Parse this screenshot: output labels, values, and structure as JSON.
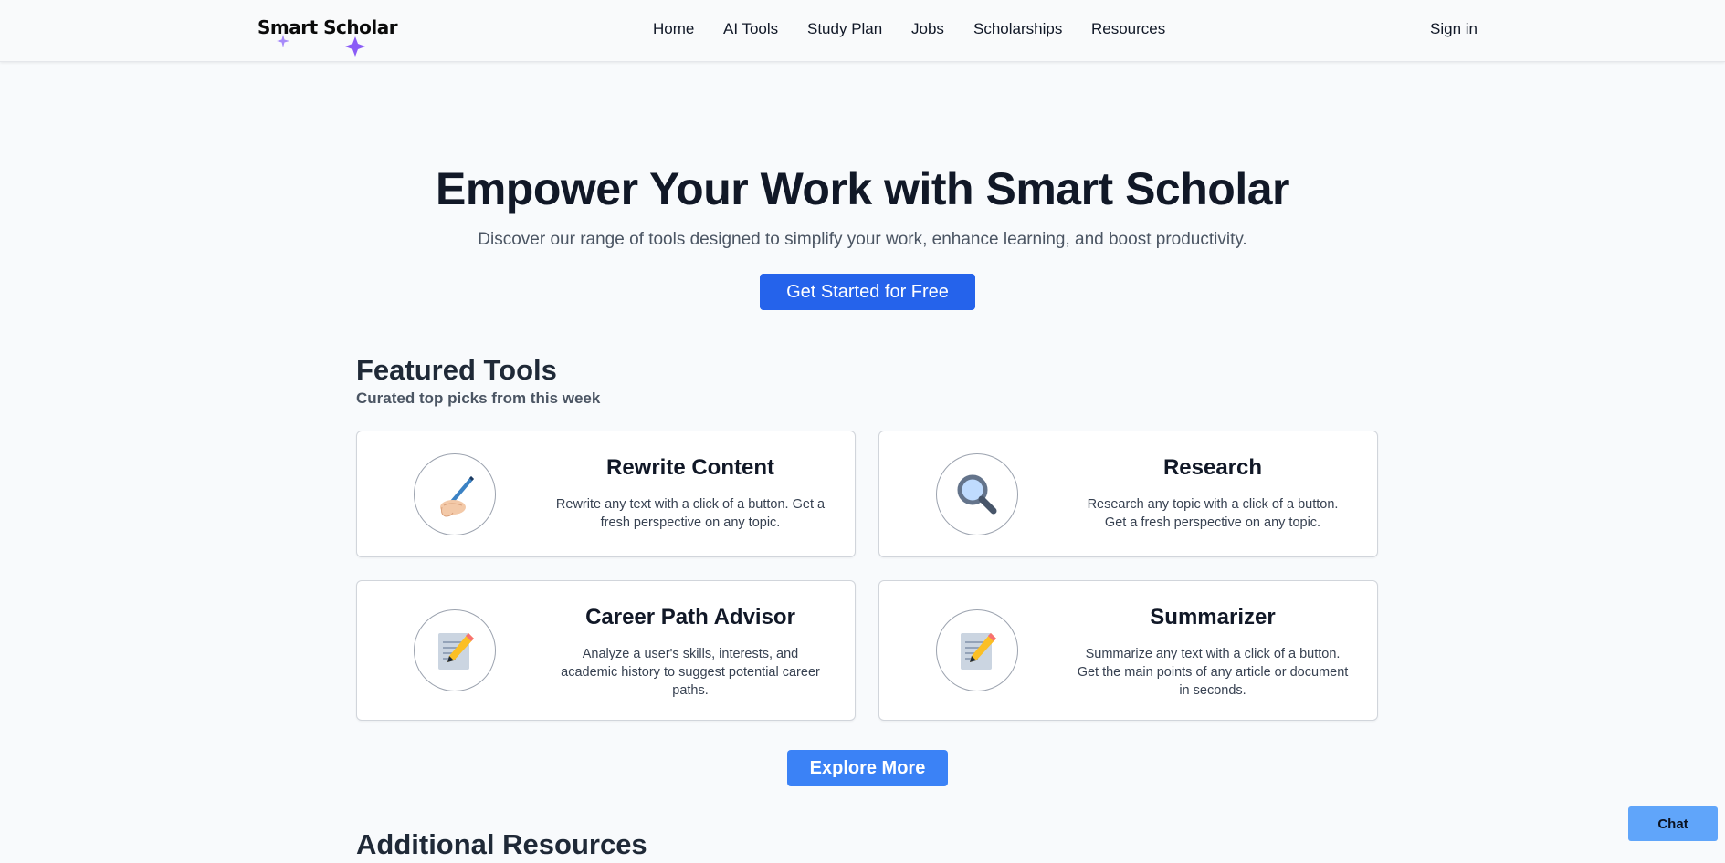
{
  "header": {
    "logo_text": "Smart Scholar",
    "nav": [
      {
        "label": "Home"
      },
      {
        "label": "AI Tools"
      },
      {
        "label": "Study Plan"
      },
      {
        "label": "Jobs"
      },
      {
        "label": "Scholarships"
      },
      {
        "label": "Resources"
      }
    ],
    "signin_label": "Sign in"
  },
  "hero": {
    "title": "Empower Your Work with Smart Scholar",
    "subtitle": "Discover our range of tools designed to simplify your work, enhance learning, and boost productivity.",
    "cta_label": "Get Started for Free"
  },
  "featured": {
    "title": "Featured Tools",
    "subtitle": "Curated top picks from this week",
    "cards": [
      {
        "title": "Rewrite Content",
        "description": "Rewrite any text with a click of a button. Get a fresh perspective on any topic.",
        "icon": "writing-hand-icon"
      },
      {
        "title": "Research",
        "description": "Research any topic with a click of a button. Get a fresh perspective on any topic.",
        "icon": "magnifying-glass-icon"
      },
      {
        "title": "Career Path Advisor",
        "description": "Analyze a user's skills, interests, and academic history to suggest potential career paths.",
        "icon": "memo-pencil-icon"
      },
      {
        "title": "Summarizer",
        "description": "Summarize any text with a click of a button. Get the main points of any article or document in seconds.",
        "icon": "memo-pencil-icon"
      }
    ],
    "explore_label": "Explore More"
  },
  "additional": {
    "title": "Additional Resources"
  },
  "chat_label": "Chat",
  "colors": {
    "primary": "#2563eb",
    "explore": "#3b82f6",
    "chat": "#60a5fa",
    "star_accent": "#a78bfa"
  }
}
